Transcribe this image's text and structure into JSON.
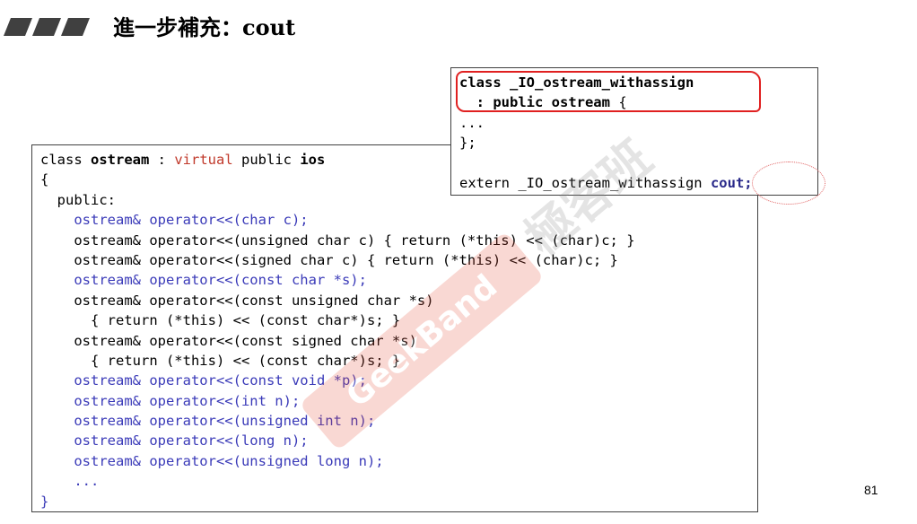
{
  "title": "進一步補充：cout",
  "page_number": "81",
  "top_box": {
    "lines": [
      [
        {
          "t": "class _IO_ostream_withassign",
          "c": "b"
        }
      ],
      [
        {
          "t": "  : public ostream",
          "c": "b"
        },
        {
          "t": " {",
          "c": ""
        }
      ],
      [
        {
          "t": "...",
          "c": ""
        }
      ],
      [
        {
          "t": "};",
          "c": ""
        }
      ],
      [
        {
          "t": "",
          "c": ""
        }
      ],
      [
        {
          "t": "extern _IO_ostream_withassign ",
          "c": ""
        },
        {
          "t": "cout;",
          "c": "blue-b"
        }
      ]
    ]
  },
  "main_box": {
    "lines": [
      [
        {
          "t": "class ",
          "c": ""
        },
        {
          "t": "ostream",
          "c": "b"
        },
        {
          "t": " : ",
          "c": ""
        },
        {
          "t": "virtual",
          "c": "kw"
        },
        {
          "t": " public ",
          "c": ""
        },
        {
          "t": "ios",
          "c": "b"
        }
      ],
      [
        {
          "t": "{",
          "c": ""
        }
      ],
      [
        {
          "t": "  public:",
          "c": ""
        }
      ],
      [
        {
          "t": "    ostream& operator<<(char c);",
          "c": "blue"
        }
      ],
      [
        {
          "t": "    ostream& operator<<(unsigned char c) { return (*this) << (char)c; }",
          "c": ""
        }
      ],
      [
        {
          "t": "    ostream& operator<<(signed char c) { return (*this) << (char)c; }",
          "c": ""
        }
      ],
      [
        {
          "t": "    ostream& operator<<(const char *s);",
          "c": "blue"
        }
      ],
      [
        {
          "t": "    ostream& operator<<(const unsigned char *s)",
          "c": ""
        }
      ],
      [
        {
          "t": "      { return (*this) << (const char*)s; }",
          "c": ""
        }
      ],
      [
        {
          "t": "    ostream& operator<<(const signed char *s)",
          "c": ""
        }
      ],
      [
        {
          "t": "      { return (*this) << (const char*)s; }",
          "c": ""
        }
      ],
      [
        {
          "t": "    ostream& operator<<(const void *p);",
          "c": "blue"
        }
      ],
      [
        {
          "t": "    ostream& operator<<(int n);",
          "c": "blue"
        }
      ],
      [
        {
          "t": "    ostream& operator<<(unsigned int n);",
          "c": "blue"
        }
      ],
      [
        {
          "t": "    ostream& operator<<(long n);",
          "c": "blue"
        }
      ],
      [
        {
          "t": "    ostream& operator<<(unsigned long n);",
          "c": "blue"
        }
      ],
      [
        {
          "t": "    ...",
          "c": "blue"
        }
      ],
      [
        {
          "t": "}",
          "c": "blue"
        }
      ]
    ]
  },
  "watermark": {
    "text": "極客班",
    "label": "GeekBand"
  }
}
